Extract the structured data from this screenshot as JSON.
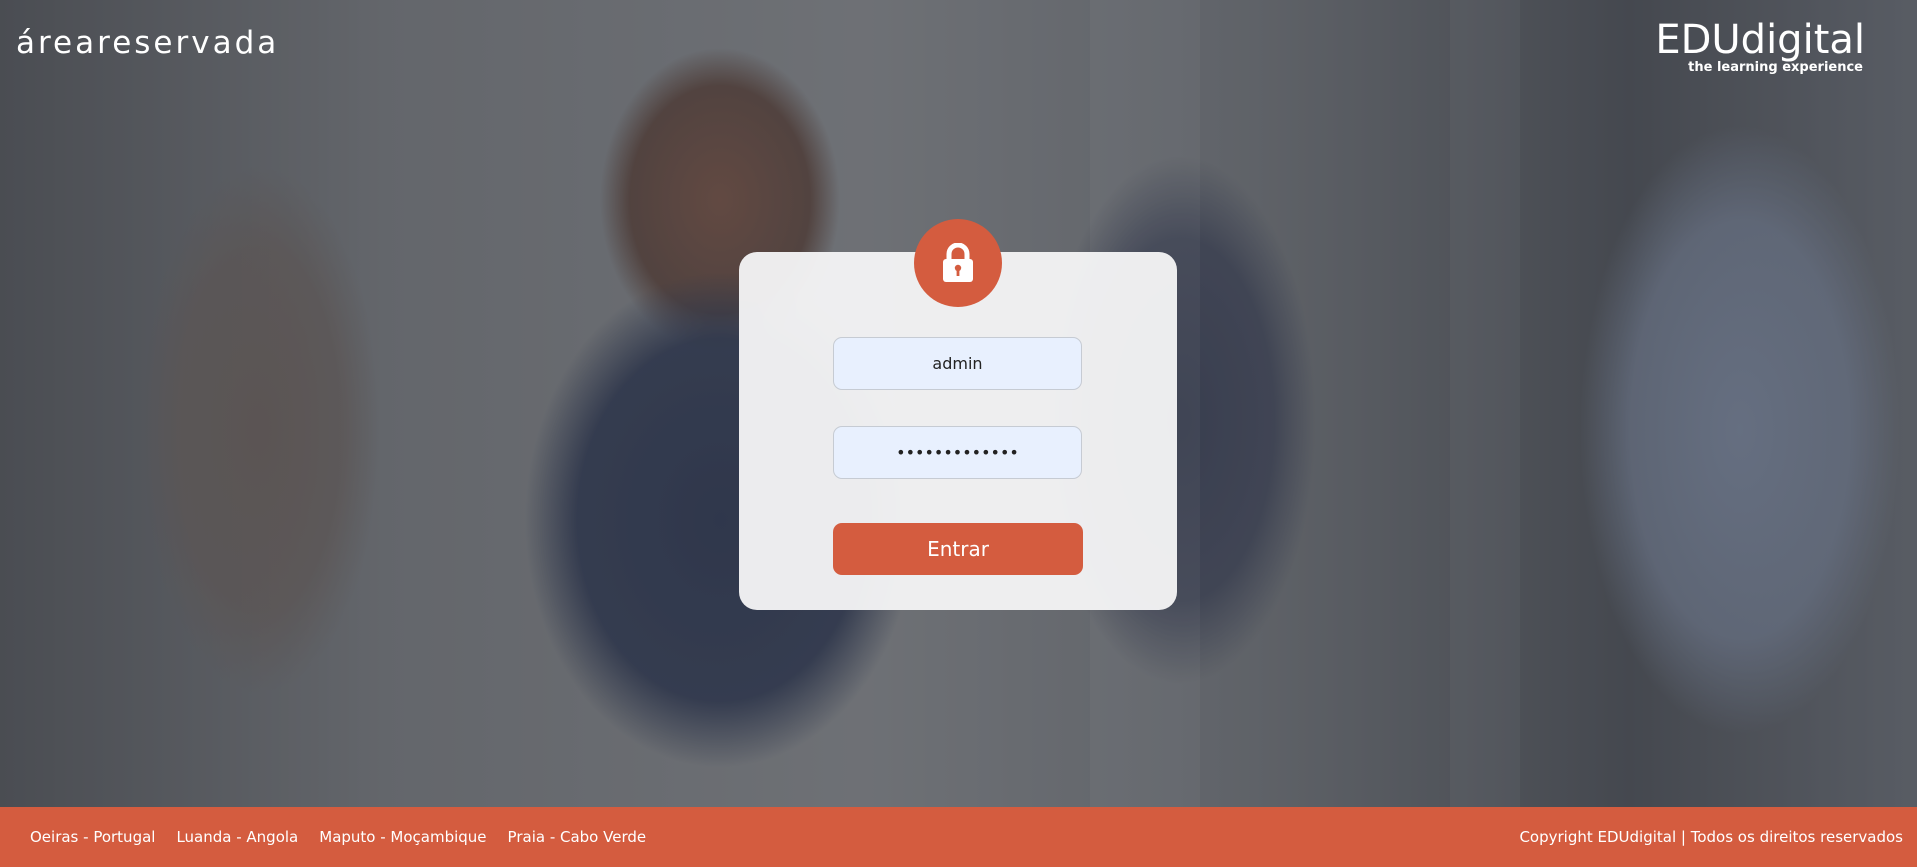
{
  "header": {
    "area_label": "áreareservada",
    "logo_main": "EDUdigital",
    "logo_sub": "the learning experience"
  },
  "login": {
    "lock_icon": "lock-icon",
    "username_value": "admin",
    "password_value": "redactedpass1",
    "submit_label": "Entrar"
  },
  "footer": {
    "locations": [
      "Oeiras - Portugal",
      "Luanda - Angola",
      "Maputo - Moçambique",
      "Praia - Cabo Verde"
    ],
    "copyright": "Copyright EDUdigital | Todos os direitos reservados"
  },
  "colors": {
    "accent": "#d45c3f",
    "input_bg": "#e8f0fe",
    "card_bg": "#f4f4f5"
  }
}
